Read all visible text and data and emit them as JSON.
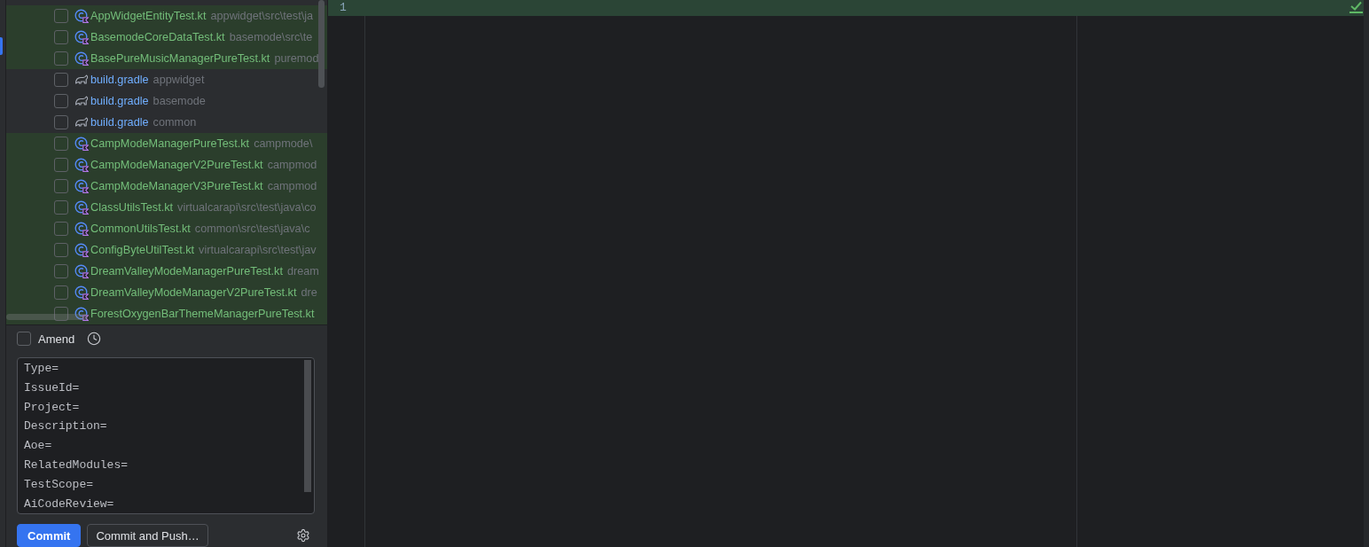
{
  "tool_stripe": {
    "selected": true
  },
  "changes": [
    {
      "kind": "kotlin-test",
      "highlighted": true,
      "color": "#73bd79",
      "checked": false,
      "name": "AppWidgetEntityTest.kt",
      "path": "appwidget\\src\\test\\ja"
    },
    {
      "kind": "kotlin-test",
      "highlighted": true,
      "color": "#73bd79",
      "checked": false,
      "name": "BasemodeCoreDataTest.kt",
      "path": "basemode\\src\\te"
    },
    {
      "kind": "kotlin-test",
      "highlighted": true,
      "color": "#73bd79",
      "checked": false,
      "name": "BasePureMusicManagerPureTest.kt",
      "path": "puremod"
    },
    {
      "kind": "gradle",
      "highlighted": false,
      "color": "#70aeff",
      "checked": false,
      "name": "build.gradle",
      "path": "appwidget"
    },
    {
      "kind": "gradle",
      "highlighted": false,
      "color": "#70aeff",
      "checked": false,
      "name": "build.gradle",
      "path": "basemode"
    },
    {
      "kind": "gradle",
      "highlighted": false,
      "color": "#70aeff",
      "checked": false,
      "name": "build.gradle",
      "path": "common"
    },
    {
      "kind": "kotlin-test",
      "highlighted": true,
      "color": "#73bd79",
      "checked": false,
      "name": "CampModeManagerPureTest.kt",
      "path": "campmode\\"
    },
    {
      "kind": "kotlin-test",
      "highlighted": true,
      "color": "#73bd79",
      "checked": false,
      "name": "CampModeManagerV2PureTest.kt",
      "path": "campmod"
    },
    {
      "kind": "kotlin-test",
      "highlighted": true,
      "color": "#73bd79",
      "checked": false,
      "name": "CampModeManagerV3PureTest.kt",
      "path": "campmod"
    },
    {
      "kind": "kotlin-test",
      "highlighted": true,
      "color": "#73bd79",
      "checked": false,
      "name": "ClassUtilsTest.kt",
      "path": "virtualcarapi\\src\\test\\java\\co"
    },
    {
      "kind": "kotlin-test",
      "highlighted": true,
      "color": "#73bd79",
      "checked": false,
      "name": "CommonUtilsTest.kt",
      "path": "common\\src\\test\\java\\c"
    },
    {
      "kind": "kotlin-test",
      "highlighted": true,
      "color": "#73bd79",
      "checked": false,
      "name": "ConfigByteUtilTest.kt",
      "path": "virtualcarapi\\src\\test\\jav"
    },
    {
      "kind": "kotlin-test",
      "highlighted": true,
      "color": "#73bd79",
      "checked": false,
      "name": "DreamValleyModeManagerPureTest.kt",
      "path": "dream"
    },
    {
      "kind": "kotlin-test",
      "highlighted": true,
      "color": "#73bd79",
      "checked": false,
      "name": "DreamValleyModeManagerV2PureTest.kt",
      "path": "dre"
    },
    {
      "kind": "kotlin-test",
      "highlighted": true,
      "color": "#73bd79",
      "checked": false,
      "name": "ForestOxygenBarThemeManagerPureTest.kt"
    }
  ],
  "amend": {
    "label": "Amend",
    "checked": false
  },
  "commit_message": {
    "lines": [
      "Type=",
      "IssueId=",
      "Project=",
      "Description=",
      "Aoe=",
      "RelatedModules=",
      "TestScope=",
      "AiCodeReview="
    ]
  },
  "buttons": [
    {
      "kind": "primary",
      "label": "Commit"
    },
    {
      "kind": "secondary",
      "label": "Commit and Push…"
    }
  ],
  "editor": {
    "lines": [
      {
        "number": "1",
        "highlighted": true
      }
    ]
  }
}
